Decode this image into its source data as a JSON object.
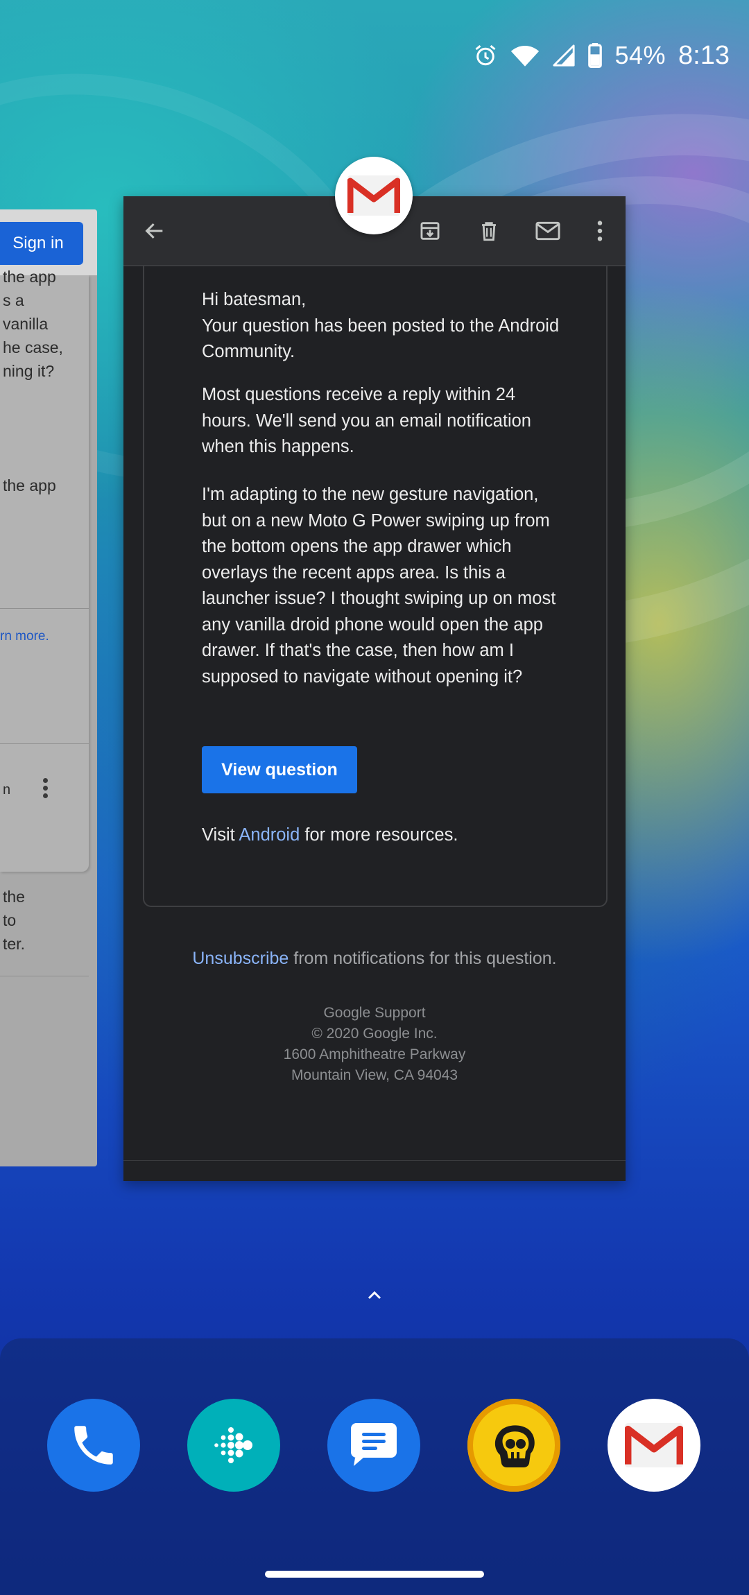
{
  "status_bar": {
    "battery": "54%",
    "time": "8:13",
    "icons": [
      "alarm-icon",
      "wifi-icon",
      "cell-signal-icon",
      "battery-icon"
    ]
  },
  "left_card": {
    "sign_in_label": "Sign in",
    "text_fragments_a": [
      "the app",
      "s a",
      "vanilla",
      "he case,",
      "ning it?"
    ],
    "learn_more": "rn more.",
    "text_fragment_n": "n",
    "text_fragments_b": [
      "the",
      "to",
      "ter."
    ]
  },
  "gmail_card": {
    "toolbar_icons": [
      "back-arrow-icon",
      "archive-icon",
      "delete-icon",
      "mark-unread-icon",
      "more-vert-icon"
    ],
    "greeting": "Hi batesman,",
    "intro": "Your question has been posted to the Android Community.",
    "reply_notice": "Most questions receive a reply within 24 hours. We'll send you an email notification when this happens.",
    "question_body": "I'm adapting to the new gesture navigation, but on a new Moto G Power swiping up from the bottom opens the app drawer which overlays the recent apps area. Is this a launcher issue? I thought swiping up on most any vanilla droid phone would open the app drawer. If that's the case, then how am I supposed to navigate without opening it?",
    "view_button_label": "View question",
    "visit_prefix": "Visit ",
    "visit_link": "Android",
    "visit_suffix": " for more resources.",
    "unsubscribe_link": "Unsubscribe",
    "unsubscribe_suffix": " from notifications for this question.",
    "footer_lines": [
      "Google Support",
      "© 2020 Google Inc.",
      "1600 Amphitheatre Parkway",
      "Mountain View, CA 94043"
    ]
  },
  "dock": {
    "apps": [
      "phone-app-icon",
      "fitbit-app-icon",
      "messages-app-icon",
      "brawl-stars-app-icon",
      "gmail-app-icon"
    ]
  },
  "colors": {
    "gmail_card_bg": "#202124",
    "link": "#8ab4f8",
    "primary_button": "#1a73e8",
    "gmail_red": "#d93025"
  }
}
